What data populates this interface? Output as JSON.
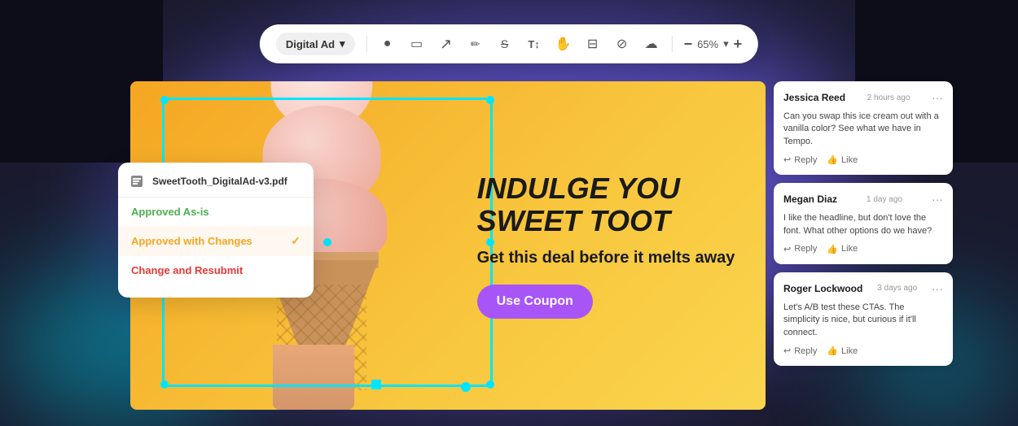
{
  "background": {
    "colors": {
      "purple": "#6b5ce7",
      "teal": "#00bcd4",
      "dark": "#0d0d1a"
    }
  },
  "toolbar": {
    "dropdown": {
      "label": "Digital Ad",
      "chevron": "▾"
    },
    "zoom": {
      "value": "65%"
    },
    "icons": [
      {
        "name": "circle-tool",
        "symbol": "●"
      },
      {
        "name": "rectangle-tool",
        "symbol": "□"
      },
      {
        "name": "arrow-tool",
        "symbol": "↗"
      },
      {
        "name": "pen-tool",
        "symbol": "✏"
      },
      {
        "name": "strikethrough-tool",
        "symbol": "S̶"
      },
      {
        "name": "text-tool",
        "symbol": "T↕"
      },
      {
        "name": "hand-tool",
        "symbol": "✋"
      },
      {
        "name": "measure-tool",
        "symbol": "⊟"
      },
      {
        "name": "hide-tool",
        "symbol": "⊘"
      },
      {
        "name": "cloud-tool",
        "symbol": "☁"
      },
      {
        "name": "zoom-out",
        "symbol": "−"
      },
      {
        "name": "zoom-in",
        "symbol": "+"
      }
    ]
  },
  "status_popup": {
    "filename": "SweetTooth_DigitalAd-v3.pdf",
    "options": [
      {
        "id": "approved-as-is",
        "label": "Approved As-is",
        "color": "#4caf50",
        "selected": false
      },
      {
        "id": "approved-with-changes",
        "label": "Approved with Changes",
        "color": "#f5a623",
        "selected": true
      },
      {
        "id": "change-and-resubmit",
        "label": "Change and Resubmit",
        "color": "#e53935",
        "selected": false
      }
    ]
  },
  "ad": {
    "headline": "INDULGE YOU SWEET TOOT",
    "subheadline": "Get this deal before it melts away",
    "cta": "Use Coupon"
  },
  "comments": [
    {
      "id": "comment-1",
      "author": "Jessica Reed",
      "time": "2 hours ago",
      "text": "Can you swap this ice cream out with a vanilla color? See what we have in Tempo.",
      "reply_label": "Reply",
      "like_label": "Like"
    },
    {
      "id": "comment-2",
      "author": "Megan Diaz",
      "time": "1 day ago",
      "text": "I like the headline, but don't love the font. What other options do we have?",
      "reply_label": "Reply",
      "like_label": "Like"
    },
    {
      "id": "comment-3",
      "author": "Roger Lockwood",
      "time": "3 days ago",
      "text": "Let's A/B test these CTAs. The simplicity is nice, but curious if it'll connect.",
      "reply_label": "Reply",
      "like_label": "Like"
    }
  ]
}
